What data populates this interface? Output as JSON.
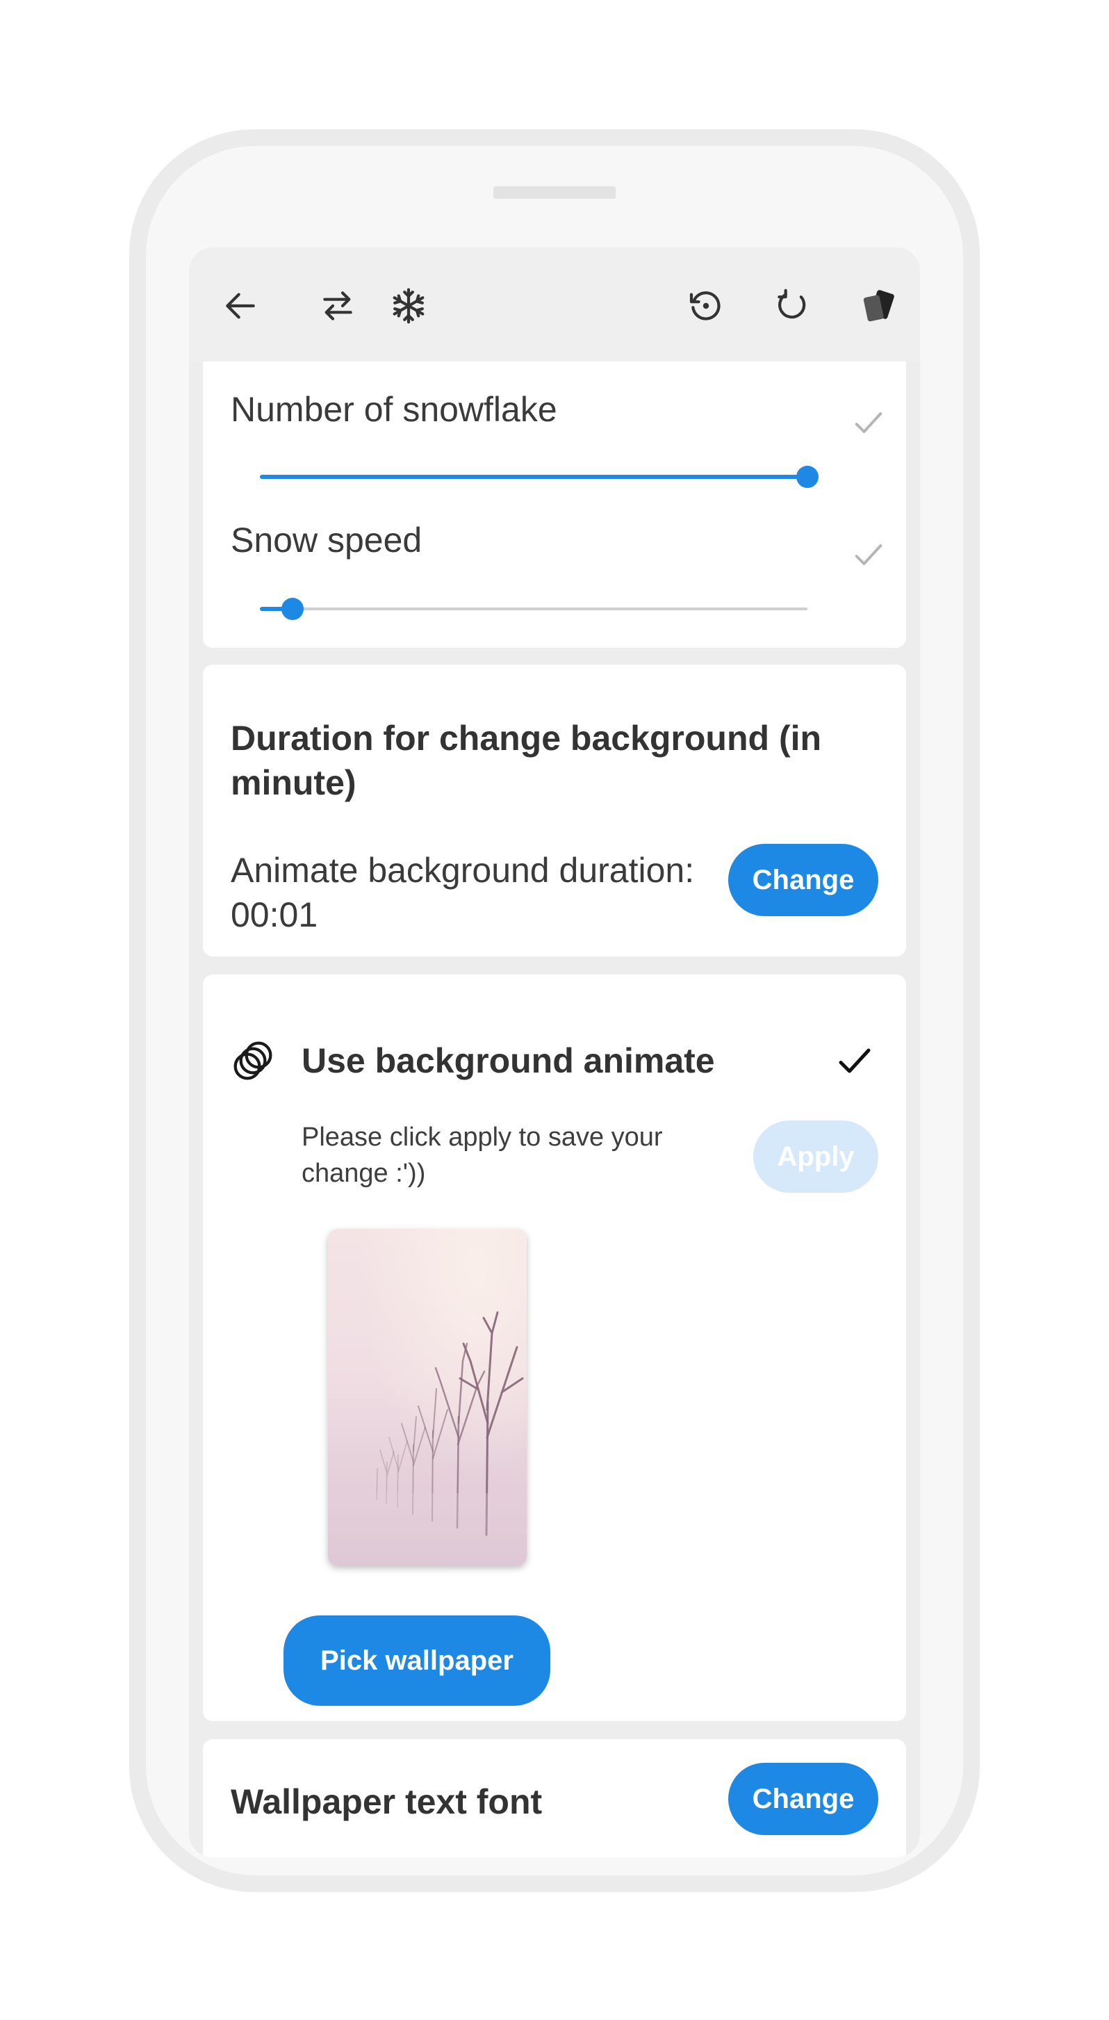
{
  "toolbar": {
    "icons": [
      "back-arrow-icon",
      "swap-icon",
      "snowflake-icon",
      "restore-icon",
      "refresh-icon",
      "cards-icon"
    ]
  },
  "snow_settings": {
    "number_label": "Number of snowflake",
    "number_level": 1.0,
    "speed_label": "Snow speed",
    "speed_level": 0.06
  },
  "duration": {
    "title": "Duration for change background (in minute)",
    "description": "Animate background duration: 00:01",
    "change_label": "Change"
  },
  "animate": {
    "title": "Use background animate",
    "hint": "Please click apply to save your change :'))",
    "apply_label": "Apply",
    "pick_label": "Pick wallpaper",
    "checked": true
  },
  "font": {
    "title": "Wallpaper text font",
    "change_label": "Change"
  },
  "colors": {
    "accent": "#1e88e5",
    "accent_disabled": "#d6e9fb",
    "text": "#3a3a3a",
    "page_bg": "#ededed"
  }
}
